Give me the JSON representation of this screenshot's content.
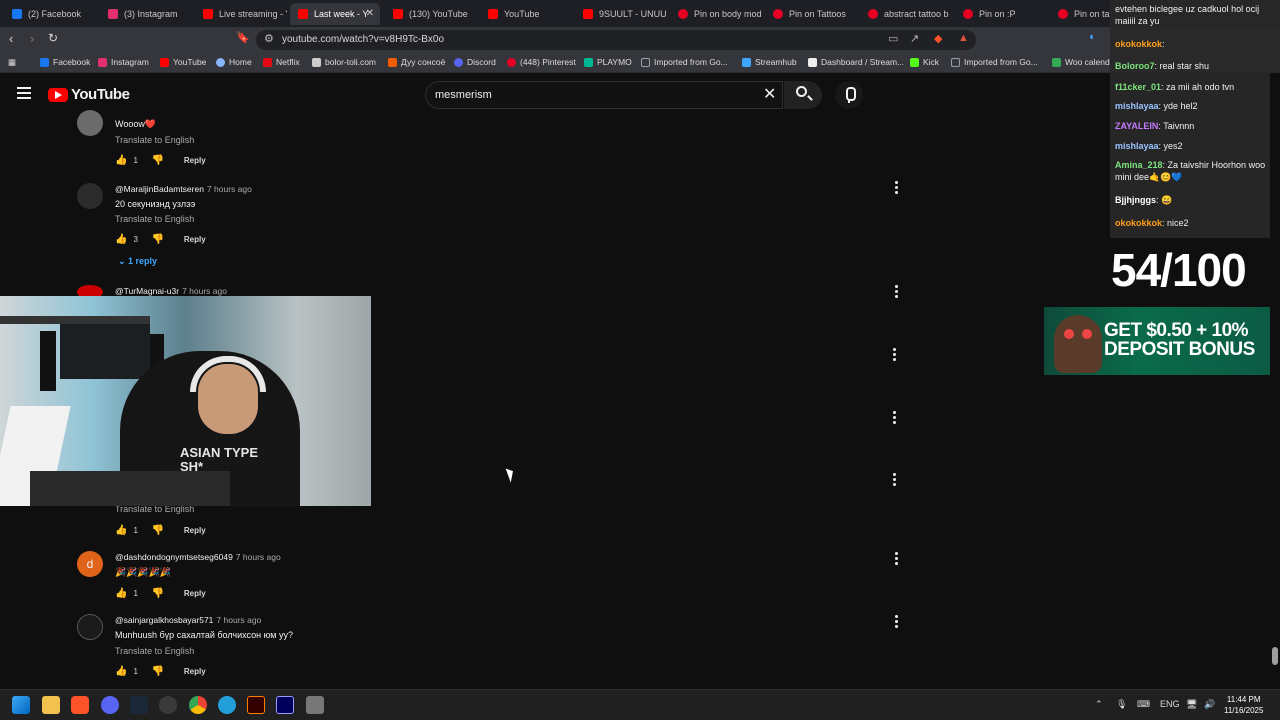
{
  "browser": {
    "tabs": [
      {
        "label": "(2) Facebook",
        "color": "#1877f2"
      },
      {
        "label": "(3) Instagram",
        "color": "#e1306c"
      },
      {
        "label": "Live streaming - Y",
        "color": "#ff0000"
      },
      {
        "label": "Last week - Y",
        "color": "#ff0000"
      },
      {
        "label": "(130) YouTube",
        "color": "#ff0000"
      },
      {
        "label": "YouTube",
        "color": "#ff0000"
      },
      {
        "label": "9SUULT - UNUU",
        "color": "#ff0000"
      },
      {
        "label": "Pin on body mod",
        "color": "#e60023"
      },
      {
        "label": "Pin on Tattoos",
        "color": "#e60023"
      },
      {
        "label": "abstract tattoo b",
        "color": "#e60023"
      },
      {
        "label": "Pin on :P",
        "color": "#e60023"
      },
      {
        "label": "Pin on tat in",
        "color": "#e60023"
      }
    ],
    "url": "youtube.com/watch?v=v8H9Tc-Bx0o",
    "bookmarks": [
      {
        "label": "Facebook",
        "color": "#1877f2"
      },
      {
        "label": "Instagram",
        "color": "#e1306c"
      },
      {
        "label": "YouTube",
        "color": "#ff0000"
      },
      {
        "label": "Home",
        "color": "#8ab4f8"
      },
      {
        "label": "Netflix",
        "color": "#e50914"
      },
      {
        "label": "bolor-toli.com",
        "color": "#cccccc"
      },
      {
        "label": "Дуу сонсоё",
        "color": "#f25c05"
      },
      {
        "label": "Discord",
        "color": "#5865f2"
      },
      {
        "label": "(448) Pinterest",
        "color": "#e60023"
      },
      {
        "label": "PLAYMO",
        "color": "#00b894"
      },
      {
        "label": "Imported from Go...",
        "color": "#9aa0a6"
      },
      {
        "label": "Streamhub",
        "color": "#3ea6ff"
      },
      {
        "label": "Dashboard / Stream...",
        "color": "#eeeeee"
      },
      {
        "label": "Kick",
        "color": "#53fc18"
      },
      {
        "label": "Imported from Go...",
        "color": "#9aa0a6"
      },
      {
        "label": "Woo calend",
        "color": "#34a853"
      }
    ]
  },
  "youtube": {
    "logo_text": "YouTube",
    "search_value": "mesmerism"
  },
  "comments": [
    {
      "user": "",
      "time": "",
      "text": "Wooow❤️",
      "translate": "Translate to English",
      "likes": "1",
      "reply": "Reply",
      "avatar_color": "#6b6b6b"
    },
    {
      "user": "@MaraljinBadamtseren",
      "time": "7 hours ago",
      "text": "20 секунизнд узлээ",
      "translate": "Translate to English",
      "likes": "3",
      "reply": "Reply",
      "avatar_color": "#2b2b2b"
    },
    {
      "user": "@TurMagnai-u3r",
      "time": "7 hours ago",
      "text": "",
      "translate": "",
      "likes": "",
      "reply": "",
      "avatar_color": "#cc0000"
    },
    {
      "user": "",
      "time": "",
      "text": "",
      "translate": "Translate to English",
      "likes": "1",
      "reply": "Reply",
      "avatar_color": "#333333"
    },
    {
      "user": "@dashdondognymtsetseg6049",
      "time": "7 hours ago",
      "text": "🎉🎉🎉🎉🎉",
      "translate": "",
      "likes": "1",
      "reply": "Reply",
      "avatar_color": "#e0631a",
      "initial": "d"
    },
    {
      "user": "@sainjargalkhosbayar571",
      "time": "7 hours ago",
      "text": "Munhuush бүр сахалтай болчихсон юм уу?",
      "translate": "Translate to English",
      "likes": "1",
      "reply": "Reply",
      "avatar_color": "#1a1a1a"
    }
  ],
  "replies_toggle": "1 reply",
  "webcam": {
    "shirt_text": "ASIAN TYPE SH*"
  },
  "chat": [
    {
      "user": "",
      "msg": "evtehen biclegee uz cadkuol hol ocij maiiil za yu",
      "color": "#ffffff"
    },
    {
      "user": "okokokkok",
      "msg": ":",
      "color": "#ff9f1a"
    },
    {
      "user": "Boloroo7",
      "msg": ": real star shu",
      "color": "#7ce37c"
    },
    {
      "user": "f11cker_01",
      "msg": ": za mii ah odo tvn",
      "color": "#7ce37c"
    },
    {
      "user": "mishlayaa",
      "msg": ": yde hel2",
      "color": "#9bc3ff"
    },
    {
      "user": "ZAYALEIN",
      "msg": ": Taivnnn",
      "color": "#c47cff"
    },
    {
      "user": "mishlayaa",
      "msg": ": yes2",
      "color": "#9bc3ff"
    },
    {
      "user": "Amina_218",
      "msg": ": Za taivshir Hoorhon woo mini dee🤙😊💙",
      "color": "#7ce37c"
    },
    {
      "user": "Bjjhjnggs",
      "msg": ": 😄",
      "color": "#ffffff"
    },
    {
      "user": "okokokkok",
      "msg": ": nice2",
      "color": "#ff9f1a"
    }
  ],
  "score": "54/100",
  "banner_text": "GET $0.50 + 10% DEPOSIT BONUS",
  "taskbar": {
    "language": "ENG",
    "time": "11:44 PM",
    "date": "11/16/2025"
  }
}
